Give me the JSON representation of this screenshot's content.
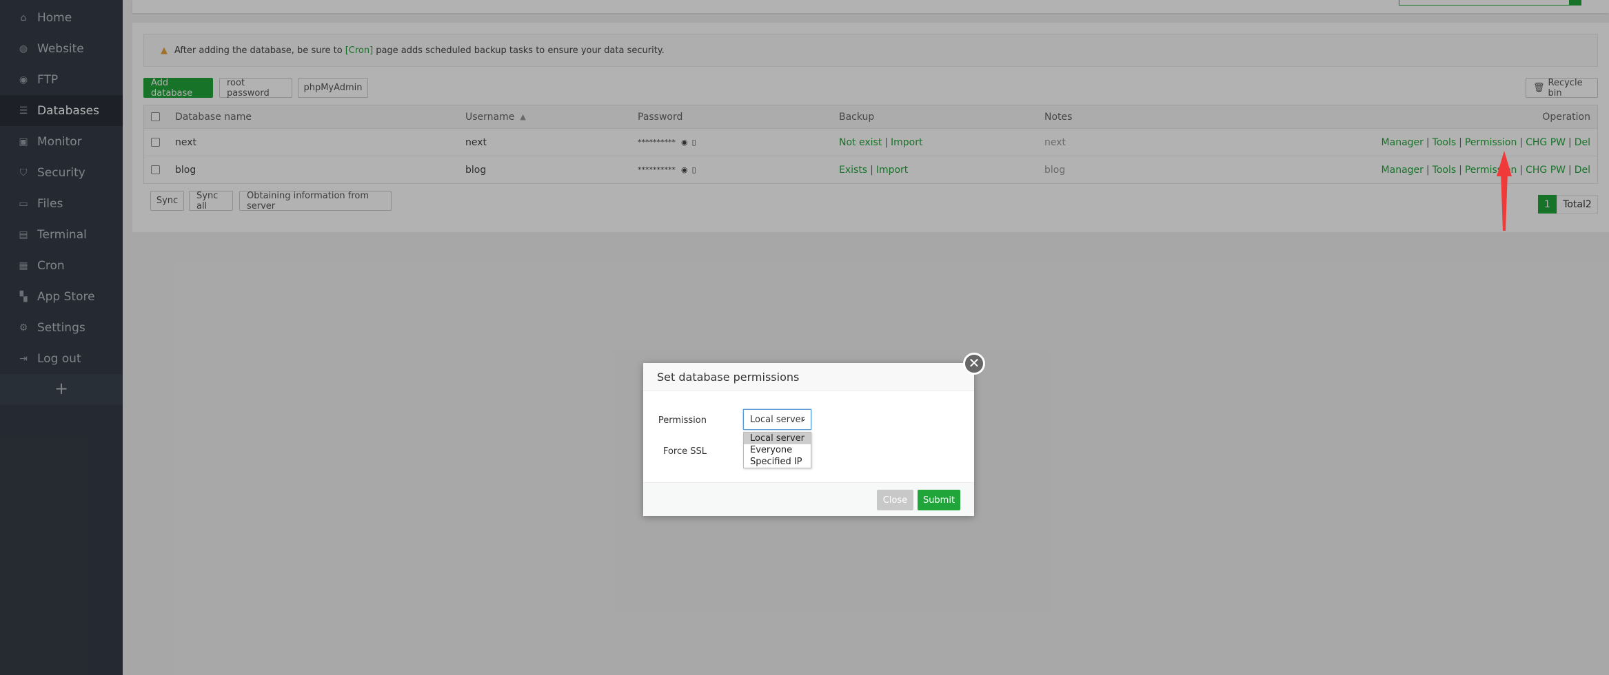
{
  "sidebar": {
    "items": [
      {
        "label": "Home",
        "icon": "home-icon",
        "glyph": "⌂"
      },
      {
        "label": "Website",
        "icon": "globe-icon",
        "glyph": "◍"
      },
      {
        "label": "FTP",
        "icon": "ftp-icon",
        "glyph": "◉"
      },
      {
        "label": "Databases",
        "icon": "database-icon",
        "glyph": "☰"
      },
      {
        "label": "Monitor",
        "icon": "monitor-icon",
        "glyph": "▣"
      },
      {
        "label": "Security",
        "icon": "shield-icon",
        "glyph": "⛉"
      },
      {
        "label": "Files",
        "icon": "folder-icon",
        "glyph": "▭"
      },
      {
        "label": "Terminal",
        "icon": "terminal-icon",
        "glyph": "▤"
      },
      {
        "label": "Cron",
        "icon": "calendar-icon",
        "glyph": "▦"
      },
      {
        "label": "App Store",
        "icon": "grid-icon",
        "glyph": "▚"
      },
      {
        "label": "Settings",
        "icon": "gear-icon",
        "glyph": "⚙"
      },
      {
        "label": "Log out",
        "icon": "logout-icon",
        "glyph": "⇥"
      }
    ],
    "active": "Databases",
    "add": "+"
  },
  "alert": {
    "before": "After adding the database, be sure to",
    "link": "[Cron]",
    "after": "page adds scheduled backup tasks to ensure your data security."
  },
  "toolbar": {
    "add": "Add database",
    "root": "root password",
    "pma": "phpMyAdmin",
    "recycle": "Recycle bin"
  },
  "table": {
    "headers": [
      "Database name",
      "Username",
      "Password",
      "Backup",
      "Notes",
      "Operation"
    ],
    "rows": [
      {
        "name": "next",
        "user": "next",
        "password": "**********",
        "backup": "Not exist",
        "import": "Import",
        "notes": "next"
      },
      {
        "name": "blog",
        "user": "blog",
        "password": "**********",
        "backup": "Exists",
        "import": "Import",
        "notes": "blog"
      }
    ],
    "ops": [
      "Manager",
      "Tools",
      "Permission",
      "CHG PW",
      "Del"
    ]
  },
  "bottom": {
    "sync": "Sync",
    "sync_all": "Sync all",
    "obtain": "Obtaining information from server"
  },
  "pager": {
    "page": "1",
    "total": "Total2"
  },
  "modal": {
    "title": "Set database permissions",
    "perm_label": "Permission",
    "selected": "Local server",
    "options": [
      "Local server",
      "Everyone",
      "Specified IP"
    ],
    "ssl_label": "Force SSL",
    "close": "Close",
    "submit": "Submit"
  },
  "colors": {
    "accent": "#20a53a",
    "arrow": "#f03a3a"
  }
}
